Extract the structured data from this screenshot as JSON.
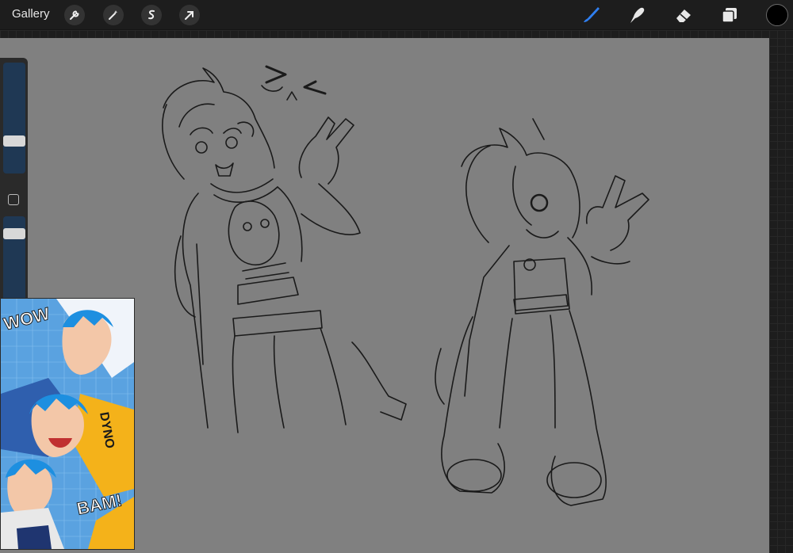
{
  "toolbar": {
    "gallery_label": "Gallery",
    "advanced_tools": [
      "wrench-icon",
      "magic-wand-icon",
      "selection-s-icon",
      "transform-arrow-icon"
    ],
    "tools": [
      "brush-icon",
      "smudge-icon",
      "eraser-icon",
      "layers-icon"
    ],
    "active_tool": "brush-icon",
    "current_color": "#000000",
    "accent": "#2f7ff0"
  },
  "sidebar": {
    "brush_size_level": 0.27,
    "opacity_level": 0.11
  },
  "reference": {
    "texts": [
      "WOW",
      "DYNO",
      "BAM!"
    ]
  }
}
